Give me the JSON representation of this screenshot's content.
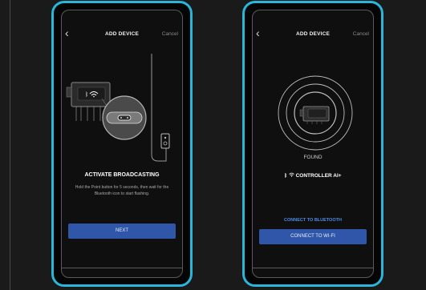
{
  "left_screen": {
    "header": {
      "back_icon": "chevron-left-icon",
      "title": "ADD DEVICE",
      "cancel": "Cancel"
    },
    "illustration": {
      "icons": [
        "controller-device-icon",
        "bluetooth-icon",
        "wifi-icon",
        "point-button-icon",
        "power-outlet-icon"
      ]
    },
    "heading": "ACTIVATE BROADCASTING",
    "body": "Hold the Point button for 5 seconds, then wait for the Bluetooth icon to start flashing.",
    "next_button": "NEXT"
  },
  "right_screen": {
    "header": {
      "back_icon": "chevron-left-icon",
      "title": "ADD DEVICE",
      "cancel": "Cancel"
    },
    "illustration": {
      "icons": [
        "radar-rings-icon",
        "controller-device-icon"
      ]
    },
    "status": "FOUND",
    "device_icons": [
      "bluetooth-icon",
      "wifi-icon"
    ],
    "device_name": "CONTROLLER AI+",
    "connect_bluetooth": "CONNECT TO BLUETOOTH",
    "connect_wifi": "CONNECT TO WI-FI"
  },
  "colors": {
    "frame_accent": "#29b6d8",
    "primary_button": "#2f56a9",
    "link": "#4e8ee6",
    "screen_bg": "#0f0f0f"
  }
}
